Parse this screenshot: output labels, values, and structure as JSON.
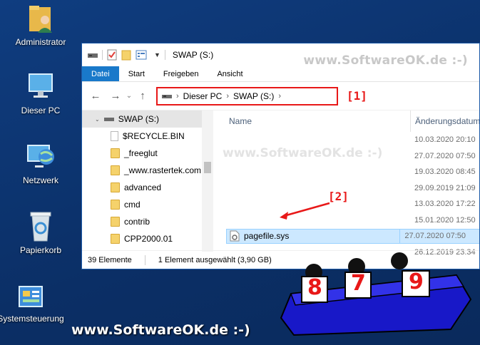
{
  "desktop": {
    "icons": [
      {
        "label": "Administrator",
        "icon": "user-folder-icon"
      },
      {
        "label": "Dieser PC",
        "icon": "computer-icon"
      },
      {
        "label": "Netzwerk",
        "icon": "network-icon"
      },
      {
        "label": "Papierkorb",
        "icon": "recycle-bin-icon"
      },
      {
        "label": "Systemsteuerung",
        "icon": "control-panel-icon"
      }
    ]
  },
  "window": {
    "title": "SWAP (S:)",
    "watermark": "www.SoftwareOK.de :-)",
    "ribbon_tabs": [
      "Datei",
      "Start",
      "Freigeben",
      "Ansicht"
    ],
    "address": {
      "segments": [
        "Dieser PC",
        "SWAP (S:)"
      ]
    },
    "annotations": {
      "address_marker": "[1]",
      "file_marker": "[2]"
    },
    "nav_tree": {
      "drive": "SWAP (S:)",
      "folders": [
        "$RECYCLE.BIN",
        "_freeglut",
        "_www.rastertek.com",
        "advanced",
        "cmd",
        "contrib",
        "CPP2000.01"
      ]
    },
    "columns": {
      "name": "Name",
      "date": "Änderungsdatum"
    },
    "dates": [
      "10.03.2020 20:10",
      "27.07.2020 07:50",
      "19.03.2020 08:45",
      "29.09.2019 21:09",
      "13.03.2020 17:22",
      "15.01.2020 12:50"
    ],
    "selected_file": {
      "name": "pagefile.sys",
      "date": "27.07.2020 07:50"
    },
    "after_date": "26.12.2019 23:34",
    "status": {
      "count": "39 Elemente",
      "selection": "1 Element ausgewählt (3,90 GB)"
    }
  },
  "overlay": {
    "watermark_mid": "www.SoftwareOK.de :-)",
    "banner": "www.SoftwareOK.de :-)",
    "scores": [
      "8",
      "7",
      "9"
    ]
  },
  "colors": {
    "accent": "#1979ca",
    "annotation": "#e81818",
    "selection": "#cce8ff",
    "desktop": "#0d2f66"
  }
}
